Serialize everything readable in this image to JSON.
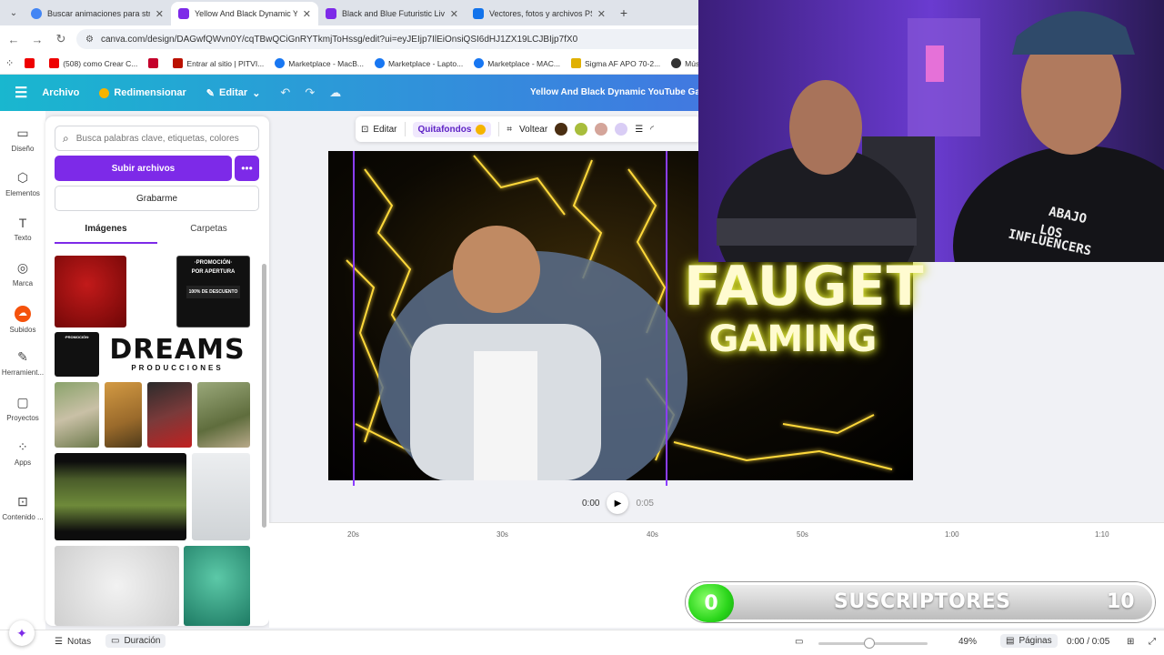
{
  "browser": {
    "tabs": [
      {
        "label": "Buscar animaciones para stream",
        "color": "#4285f4",
        "active": false
      },
      {
        "label": "Yellow And Black Dynamic YouTube",
        "color": "#7d2ae8",
        "active": true
      },
      {
        "label": "Black and Blue Futuristic Live St",
        "color": "#7d2ae8",
        "active": false
      },
      {
        "label": "Vectores, fotos y archivos PSD g",
        "color": "#1273eb",
        "active": false
      }
    ],
    "new_tab": "+",
    "url": "canva.com/design/DAGwfQWvn0Y/cqTBwQCiGnRYTkmjToHssg/edit?ui=eyJEIjp7IlEiOnsiQSI6dHJ1ZX19LCJBIjp7fX0",
    "bookmarks": [
      {
        "label": "",
        "color": "#e00"
      },
      {
        "label": "(508) como Crear C...",
        "color": "#e00"
      },
      {
        "label": "",
        "color": "#c4002b"
      },
      {
        "label": "Entrar al sitio | PITVI...",
        "color": "#b10"
      },
      {
        "label": "Marketplace - MacB...",
        "color": "#1877f2"
      },
      {
        "label": "Marketplace - Lapto...",
        "color": "#1877f2"
      },
      {
        "label": "Marketplace - MAC...",
        "color": "#1877f2"
      },
      {
        "label": "Sigma AF APO 70-2...",
        "color": "#e0b000"
      },
      {
        "label": "Música gr",
        "color": "#333"
      }
    ]
  },
  "header": {
    "file": "Archivo",
    "resize": "Redimensionar",
    "edit": "Editar",
    "title": "Yellow And Black Dynamic YouTube Gam"
  },
  "rail": [
    {
      "label": "Diseño",
      "icon": "▭"
    },
    {
      "label": "Elementos",
      "icon": "⬡"
    },
    {
      "label": "Texto",
      "icon": "T"
    },
    {
      "label": "Marca",
      "icon": "◎"
    },
    {
      "label": "Subidos",
      "icon": "☁"
    },
    {
      "label": "Herramient...",
      "icon": "✎"
    },
    {
      "label": "Proyectos",
      "icon": "▢"
    },
    {
      "label": "Apps",
      "icon": "⁘"
    },
    {
      "label": "Contenido ...",
      "icon": "⊡"
    }
  ],
  "panel": {
    "search_placeholder": "Busca palabras clave, etiquetas, colores",
    "upload": "Subir archivos",
    "more": "•••",
    "record": "Grabarme",
    "tab_images": "Imágenes",
    "tab_folders": "Carpetas",
    "promo_title": "·PROMOCIÓN·",
    "promo_sub": "POR APERTURA",
    "promo_discount": "100% DE DESCUENTO",
    "promo_small": "·PROMOCIÓN·",
    "dreams": "DREAMS",
    "dreams_sub": "PRODUCCIONES"
  },
  "toolbar": {
    "edit": "Editar",
    "bg_remove": "Quitafondos",
    "flip": "Voltear",
    "swatches": [
      "#4a2e12",
      "#a8bd3c",
      "#d4a59a",
      "#d9cdf5"
    ]
  },
  "canvas": {
    "line1": "FAUGET",
    "line2": "GAMING"
  },
  "playback": {
    "current": "0:00",
    "total": "0:05"
  },
  "timeline": {
    "ticks": [
      "20s",
      "30s",
      "40s",
      "50s",
      "1:00",
      "1:10"
    ]
  },
  "webcam": {
    "shirt_line1": "ABAJO",
    "shirt_line2": "LOS",
    "shirt_line3": "INFLUENCERS"
  },
  "subscribers": {
    "current": "0",
    "label": "SUSCRIPTORES",
    "goal": "10"
  },
  "footer": {
    "notes": "Notas",
    "duration": "Duración",
    "zoom": "49%",
    "pages": "Páginas",
    "time": "0:00 / 0:05"
  }
}
